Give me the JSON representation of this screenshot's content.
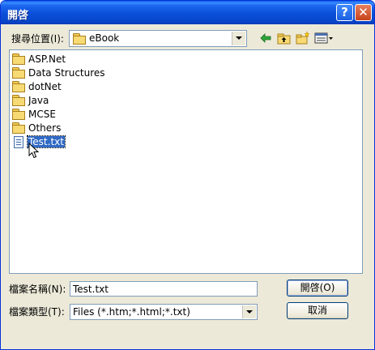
{
  "window": {
    "title": "開啓",
    "help_glyph": "?",
    "close_glyph": "✕"
  },
  "lookin": {
    "label": "搜尋位置(I):",
    "value": "eBook"
  },
  "toolbar": {
    "back_icon": "back-arrow-icon",
    "up_icon": "up-folder-icon",
    "new_folder_icon": "new-folder-icon",
    "view_icon": "view-menu-icon"
  },
  "files": [
    {
      "name": "ASP.Net",
      "type": "folder"
    },
    {
      "name": "Data Structures",
      "type": "folder"
    },
    {
      "name": "dotNet",
      "type": "folder"
    },
    {
      "name": "Java",
      "type": "folder"
    },
    {
      "name": "MCSE",
      "type": "folder"
    },
    {
      "name": "Others",
      "type": "folder"
    },
    {
      "name": "Test.txt",
      "type": "file",
      "selected": true
    }
  ],
  "filename": {
    "label": "檔案名稱(N):",
    "value": "Test.txt"
  },
  "filetype": {
    "label": "檔案類型(T):",
    "value": "Files (*.htm;*.html;*.txt)"
  },
  "buttons": {
    "open": "開啓(O)",
    "cancel": "取消"
  },
  "colors": {
    "titlebar": "#0a4fd8",
    "selection": "#316ac5",
    "dialog_bg": "#ece9d8"
  }
}
